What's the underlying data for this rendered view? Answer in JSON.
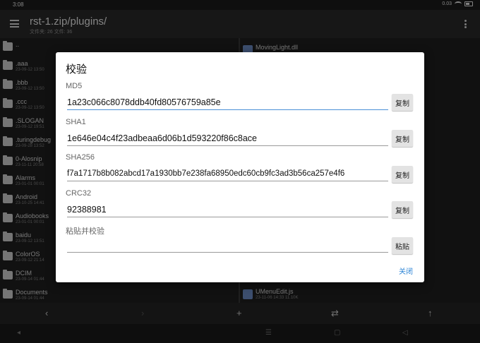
{
  "status": {
    "time": "3:08",
    "speed": "0.03\nKB/s"
  },
  "appbar": {
    "title": "rst-1.zip/plugins/",
    "subtitle": "文件夹: 26  文件: 36"
  },
  "left_files": [
    {
      "name": "..",
      "meta": ""
    },
    {
      "name": ".aaa",
      "meta": "23-09-12 13:50"
    },
    {
      "name": ".bbb",
      "meta": "23-09-12 13:50"
    },
    {
      "name": ".ccc",
      "meta": "23-09-12 13:50"
    },
    {
      "name": ".SLOGAN",
      "meta": "23-09-12 19:51"
    },
    {
      "name": ".turingdebug",
      "meta": "23-09-28 13:52"
    },
    {
      "name": "0-Alosnip",
      "meta": "23-11-11 20:58"
    },
    {
      "name": "Alarms",
      "meta": "23-01-01 00:01"
    },
    {
      "name": "Android",
      "meta": "23-10-25 14:41"
    },
    {
      "name": "Audiobooks",
      "meta": "23-01-01 00:01"
    },
    {
      "name": "baidu",
      "meta": "23-09-12 13:51"
    },
    {
      "name": "ColorOS",
      "meta": "23-09-12 21:14"
    },
    {
      "name": "DCIM",
      "meta": "23-09-14 01:44"
    },
    {
      "name": "Documents",
      "meta": "23-09-14 01:44"
    }
  ],
  "right_files": {
    "top": {
      "name": "MovingLight.dll",
      "meta": ""
    },
    "bottom": {
      "name": "UMenuEdit.js",
      "meta": "23-11-06 14:33  11.10K"
    }
  },
  "dialog": {
    "title": "校验",
    "md5": {
      "label": "MD5",
      "value": "1a23c066c8078ddb40fd80576759a85e",
      "button": "复制"
    },
    "sha1": {
      "label": "SHA1",
      "value": "1e646e04c4f23adbeaa6d06b1d593220f86c8ace",
      "button": "复制"
    },
    "sha256": {
      "label": "SHA256",
      "value": "f7a1717b8b082abcd17a1930bb7e238fa68950edc60cb9fc3ad3b56ca257e4f6",
      "button": "复制"
    },
    "crc32": {
      "label": "CRC32",
      "value": "92388981",
      "button": "复制"
    },
    "paste": {
      "label": "粘贴并校验",
      "value": "",
      "button": "粘贴"
    },
    "close": "关闭"
  },
  "toolbar": {
    "back": "‹",
    "forward": "›",
    "add": "+",
    "swap": "⇄",
    "up": "↑"
  },
  "navbar": {
    "back": "◂",
    "recent": "☰",
    "home": "▢",
    "back2": "◁"
  }
}
